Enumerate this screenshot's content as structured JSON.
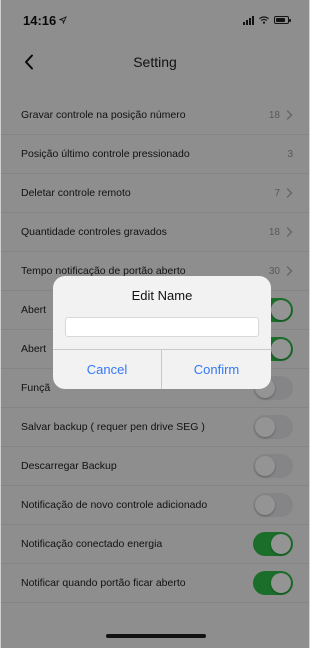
{
  "status_bar": {
    "time": "14:16"
  },
  "nav": {
    "title": "Setting"
  },
  "settings": [
    {
      "label": "Gravar controle na posição número",
      "value": "18",
      "control": "chevron"
    },
    {
      "label": "Posição último controle pressionado",
      "value": "3",
      "control": "none"
    },
    {
      "label": "Deletar controle remoto",
      "value": "7",
      "control": "chevron"
    },
    {
      "label": "Quantidade controles gravados",
      "value": "18",
      "control": "chevron"
    },
    {
      "label": "Tempo notificação de portão aberto",
      "value": "30",
      "control": "chevron"
    },
    {
      "label": "Abert",
      "control": "toggle",
      "on": true
    },
    {
      "label": "Abert",
      "control": "toggle",
      "on": true
    },
    {
      "label": "Funçã",
      "control": "toggle",
      "on": false
    },
    {
      "label": "Salvar backup ( requer pen drive SEG )",
      "control": "toggle",
      "on": false
    },
    {
      "label": "Descarregar Backup",
      "control": "toggle",
      "on": false
    },
    {
      "label": "Notificação de novo controle adicionado",
      "control": "toggle",
      "on": false
    },
    {
      "label": "Notificação conectado energia",
      "control": "toggle",
      "on": true
    },
    {
      "label": "Notificar quando portão ficar aberto",
      "control": "toggle",
      "on": true
    }
  ],
  "dialog": {
    "title": "Edit Name",
    "input_value": "",
    "cancel_label": "Cancel",
    "confirm_label": "Confirm"
  },
  "colors": {
    "toggle_on": "#2fbd48",
    "toggle_off": "#e6e6e9",
    "dialog_button": "#3478f6"
  },
  "icons": {
    "back": "chevron-left-icon",
    "row_arrow": "chevron-right-icon",
    "location": "location-arrow-icon"
  }
}
